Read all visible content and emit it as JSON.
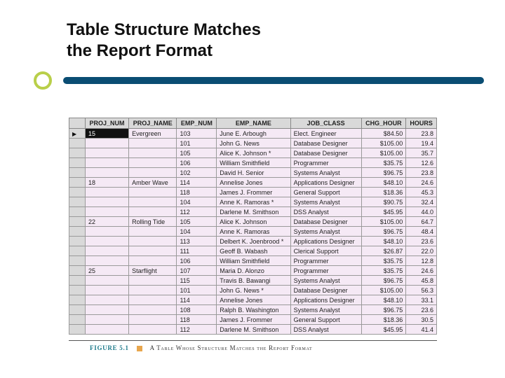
{
  "title": {
    "line1": "Table Structure Matches",
    "line2": "the Report Format"
  },
  "table": {
    "columns": [
      "PROJ_NUM",
      "PROJ_NAME",
      "EMP_NUM",
      "EMP_NAME",
      "JOB_CLASS",
      "CHG_HOUR",
      "HOURS"
    ],
    "rows": [
      {
        "pointer": true,
        "selected": true,
        "proj_num": "15",
        "proj_name": "Evergreen",
        "emp_num": "103",
        "emp_name": "June E. Arbough",
        "job_class": "Elect. Engineer",
        "chg_hour": "$84.50",
        "hours": "23.8"
      },
      {
        "proj_num": "",
        "proj_name": "",
        "emp_num": "101",
        "emp_name": "John G. News",
        "job_class": "Database Designer",
        "chg_hour": "$105.00",
        "hours": "19.4"
      },
      {
        "proj_num": "",
        "proj_name": "",
        "emp_num": "105",
        "emp_name": "Alice K. Johnson *",
        "job_class": "Database Designer",
        "chg_hour": "$105.00",
        "hours": "35.7"
      },
      {
        "proj_num": "",
        "proj_name": "",
        "emp_num": "106",
        "emp_name": "William Smithfield",
        "job_class": "Programmer",
        "chg_hour": "$35.75",
        "hours": "12.6"
      },
      {
        "proj_num": "",
        "proj_name": "",
        "emp_num": "102",
        "emp_name": "David H. Senior",
        "job_class": "Systems Analyst",
        "chg_hour": "$96.75",
        "hours": "23.8"
      },
      {
        "proj_num": "18",
        "proj_name": "Amber Wave",
        "emp_num": "114",
        "emp_name": "Annelise Jones",
        "job_class": "Applications Designer",
        "chg_hour": "$48.10",
        "hours": "24.6"
      },
      {
        "proj_num": "",
        "proj_name": "",
        "emp_num": "118",
        "emp_name": "James J. Frommer",
        "job_class": "General Support",
        "chg_hour": "$18.36",
        "hours": "45.3"
      },
      {
        "proj_num": "",
        "proj_name": "",
        "emp_num": "104",
        "emp_name": "Anne K. Ramoras *",
        "job_class": "Systems Analyst",
        "chg_hour": "$90.75",
        "hours": "32.4"
      },
      {
        "proj_num": "",
        "proj_name": "",
        "emp_num": "112",
        "emp_name": "Darlene M. Smithson",
        "job_class": "DSS Analyst",
        "chg_hour": "$45.95",
        "hours": "44.0"
      },
      {
        "proj_num": "22",
        "proj_name": "Rolling Tide",
        "emp_num": "105",
        "emp_name": "Alice K. Johnson",
        "job_class": "Database Designer",
        "chg_hour": "$105.00",
        "hours": "64.7"
      },
      {
        "proj_num": "",
        "proj_name": "",
        "emp_num": "104",
        "emp_name": "Anne K. Ramoras",
        "job_class": "Systems Analyst",
        "chg_hour": "$96.75",
        "hours": "48.4"
      },
      {
        "proj_num": "",
        "proj_name": "",
        "emp_num": "113",
        "emp_name": "Delbert K. Joenbrood *",
        "job_class": "Applications Designer",
        "chg_hour": "$48.10",
        "hours": "23.6"
      },
      {
        "proj_num": "",
        "proj_name": "",
        "emp_num": "111",
        "emp_name": "Geoff B. Wabash",
        "job_class": "Clerical Support",
        "chg_hour": "$26.87",
        "hours": "22.0"
      },
      {
        "proj_num": "",
        "proj_name": "",
        "emp_num": "106",
        "emp_name": "William Smithfield",
        "job_class": "Programmer",
        "chg_hour": "$35.75",
        "hours": "12.8"
      },
      {
        "proj_num": "25",
        "proj_name": "Starflight",
        "emp_num": "107",
        "emp_name": "Maria D. Alonzo",
        "job_class": "Programmer",
        "chg_hour": "$35.75",
        "hours": "24.6"
      },
      {
        "proj_num": "",
        "proj_name": "",
        "emp_num": "115",
        "emp_name": "Travis B. Bawangi",
        "job_class": "Systems Analyst",
        "chg_hour": "$96.75",
        "hours": "45.8"
      },
      {
        "proj_num": "",
        "proj_name": "",
        "emp_num": "101",
        "emp_name": "John G. News *",
        "job_class": "Database Designer",
        "chg_hour": "$105.00",
        "hours": "56.3"
      },
      {
        "proj_num": "",
        "proj_name": "",
        "emp_num": "114",
        "emp_name": "Annelise Jones",
        "job_class": "Applications Designer",
        "chg_hour": "$48.10",
        "hours": "33.1"
      },
      {
        "proj_num": "",
        "proj_name": "",
        "emp_num": "108",
        "emp_name": "Ralph B. Washington",
        "job_class": "Systems Analyst",
        "chg_hour": "$96.75",
        "hours": "23.6"
      },
      {
        "proj_num": "",
        "proj_name": "",
        "emp_num": "118",
        "emp_name": "James J. Frommer",
        "job_class": "General Support",
        "chg_hour": "$18.36",
        "hours": "30.5"
      },
      {
        "proj_num": "",
        "proj_name": "",
        "emp_num": "112",
        "emp_name": "Darlene M. Smithson",
        "job_class": "DSS Analyst",
        "chg_hour": "$45.95",
        "hours": "41.4"
      }
    ]
  },
  "caption": {
    "label": "FIGURE 5.1",
    "text": "A Table Whose Structure Matches the Report Format"
  }
}
